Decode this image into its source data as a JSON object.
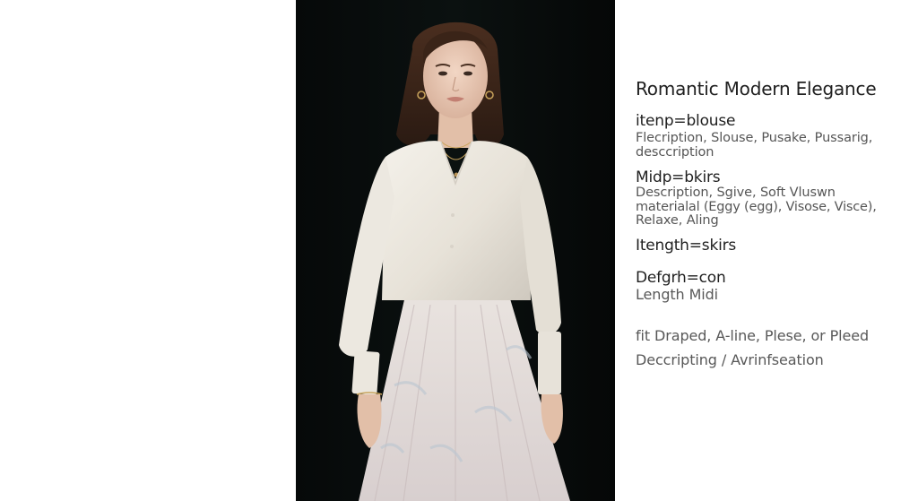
{
  "title": "Romantic Modern Elegance",
  "sections": [
    {
      "heading": "itenp=blouse",
      "lines": [
        "Flecription, Slouse, Pusake, Pussarig,",
        "desccription"
      ]
    },
    {
      "heading": "Midp=bkirs",
      "lines": [
        "Description, Sgive, Soft Vluswn",
        "materialal (Eggy (egg), Visose, Visce),",
        "Relaxe, Aling"
      ]
    },
    {
      "heading": "Itength=skirs",
      "lines": []
    },
    {
      "heading": "Defgrh=con",
      "lines": [
        "Length Midi"
      ]
    }
  ],
  "footer": {
    "line1": "fit Draped, A-line, Plese, or Pleed",
    "line2": "Deccripting / Avrinfseation"
  }
}
